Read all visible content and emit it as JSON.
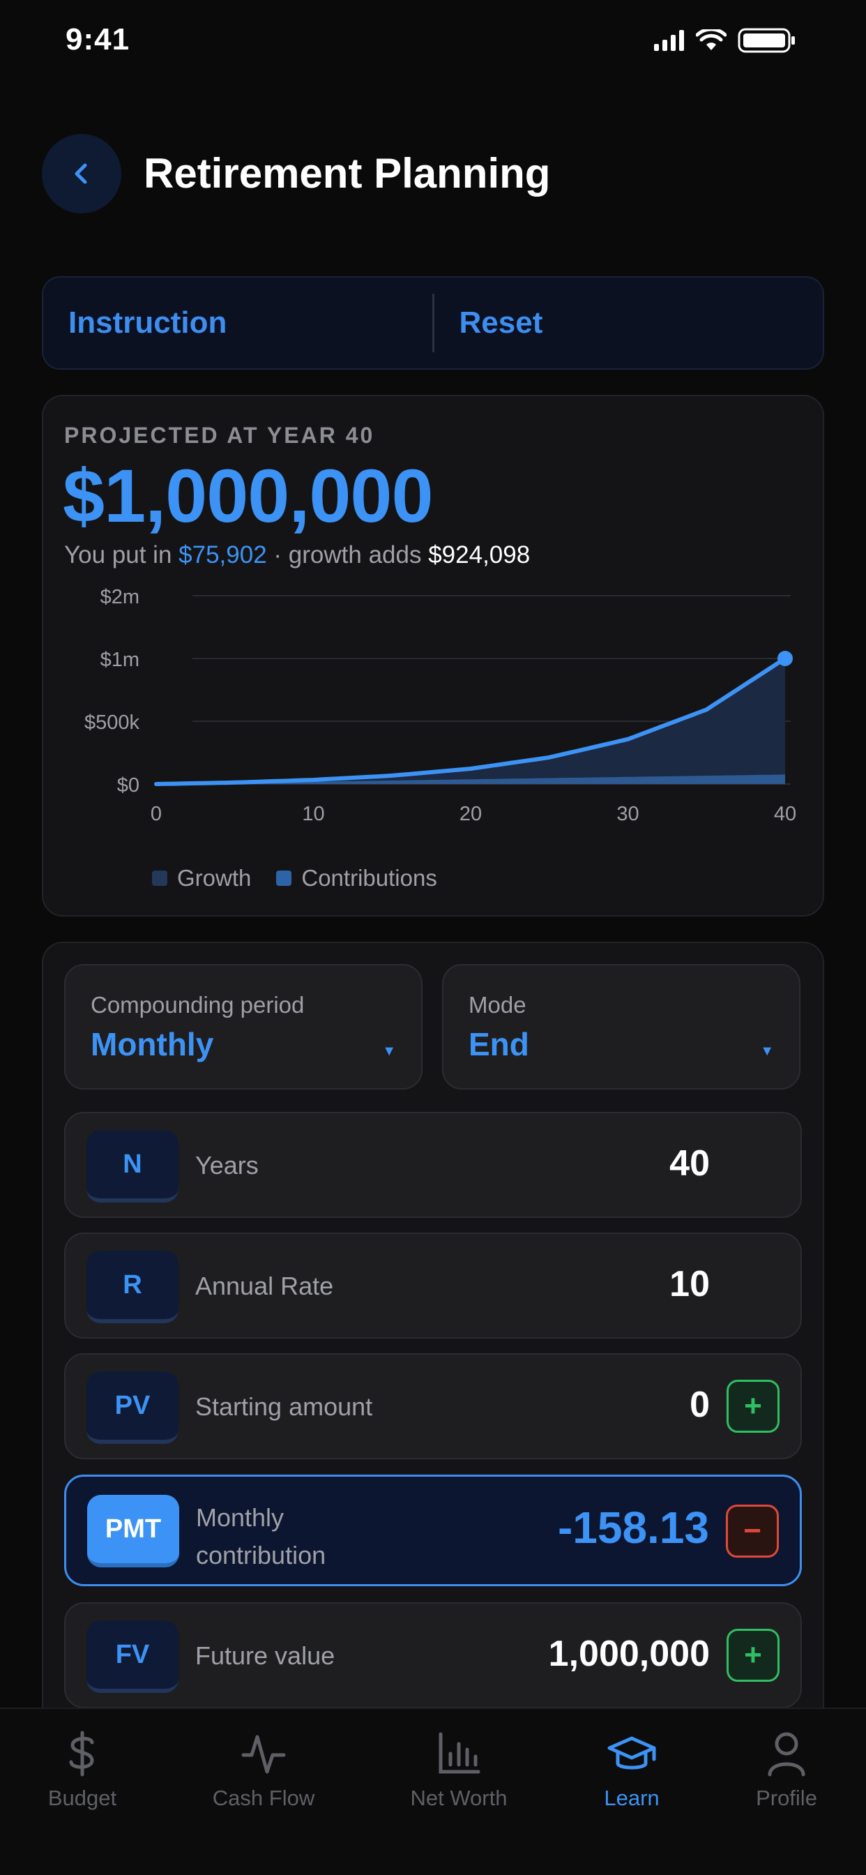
{
  "status": {
    "time": "9:41"
  },
  "header": {
    "title": "Retirement Planning"
  },
  "actions": {
    "instruction_label": "Instruction",
    "reset_label": "Reset"
  },
  "summary": {
    "label": "PROJECTED AT YEAR 40",
    "value": "$1,000,000",
    "sub_prefix": "You put in",
    "contributed": "$75,902",
    "sub_mid": "· growth adds",
    "growth": "$924,098"
  },
  "chart_data": {
    "type": "area",
    "x": [
      0,
      5,
      10,
      15,
      20,
      25,
      30,
      35,
      40
    ],
    "series": [
      {
        "name": "Growth",
        "values": [
          0,
          12000,
          33000,
          67000,
          122000,
          212000,
          357000,
          593000,
          1000000
        ]
      },
      {
        "name": "Contributions",
        "values": [
          0,
          9488,
          18975,
          28463,
          37951,
          47439,
          56926,
          66414,
          75902
        ]
      }
    ],
    "y_ticks": [
      "$0",
      "$500k",
      "$1m",
      "$2m"
    ],
    "x_ticks": [
      "0",
      "10",
      "20",
      "30",
      "40"
    ],
    "ylim": [
      0,
      1500000
    ],
    "xlim": [
      0,
      40
    ],
    "colors": {
      "line": "#3d93f5",
      "growth_fill": "#1b2a45",
      "contrib_fill": "#2d5a93",
      "grid": "#2a2b30"
    }
  },
  "legend": {
    "growth": "Growth",
    "contributions": "Contributions"
  },
  "selects": {
    "compounding": {
      "label": "Compounding period",
      "value": "Monthly"
    },
    "mode": {
      "label": "Mode",
      "value": "End"
    }
  },
  "rows": [
    {
      "badge": "N",
      "label": "Years",
      "value": "40"
    },
    {
      "badge": "R",
      "label": "Annual Rate",
      "value": "10"
    },
    {
      "badge": "PV",
      "label": "Starting amount",
      "value": "0",
      "op": "+"
    },
    {
      "badge": "PMT",
      "label_line1": "Monthly",
      "label_line2": "contribution",
      "value": "-158.13",
      "op": "−"
    },
    {
      "badge": "FV",
      "label": "Future value",
      "value": "1,000,000",
      "op": "+"
    }
  ],
  "nav": [
    {
      "label": "Budget",
      "icon": "dollar-icon"
    },
    {
      "label": "Cash Flow",
      "icon": "pulse-icon"
    },
    {
      "label": "Net Worth",
      "icon": "bar-chart-icon"
    },
    {
      "label": "Learn",
      "icon": "graduation-cap-icon"
    },
    {
      "label": "Profile",
      "icon": "person-icon"
    }
  ]
}
